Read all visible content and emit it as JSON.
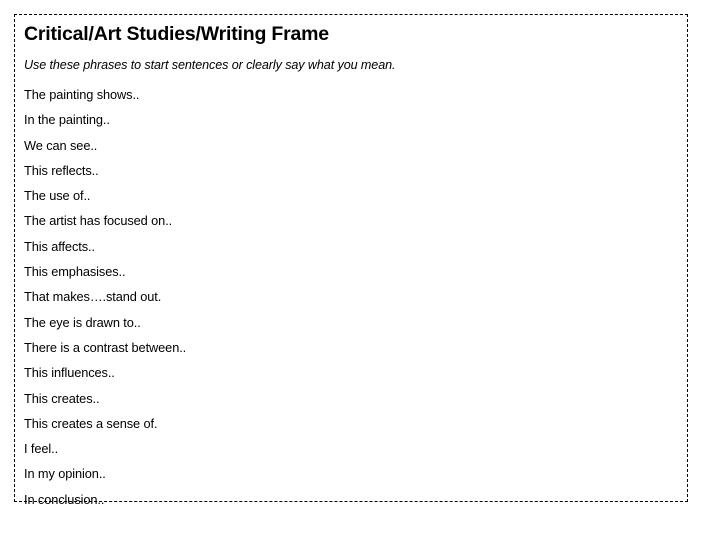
{
  "document": {
    "title": "Critical/Art Studies/Writing Frame",
    "subtitle": "Use these phrases to start sentences or clearly say what you mean.",
    "text_color": "#000000",
    "background_color": "#ffffff",
    "border_style": "dashed",
    "border_color": "#000000",
    "phrases": [
      "The painting shows..",
      "In the painting..",
      "We can see..",
      "This reflects..",
      "The use of..",
      "The artist has focused on..",
      "This affects..",
      "This emphasises..",
      "That makes….stand out.",
      "The eye is drawn to..",
      "There is a contrast between..",
      "This influences..",
      "This creates..",
      "This creates a sense of.",
      "I feel..",
      "In my opinion..",
      "In conclusion.."
    ]
  }
}
